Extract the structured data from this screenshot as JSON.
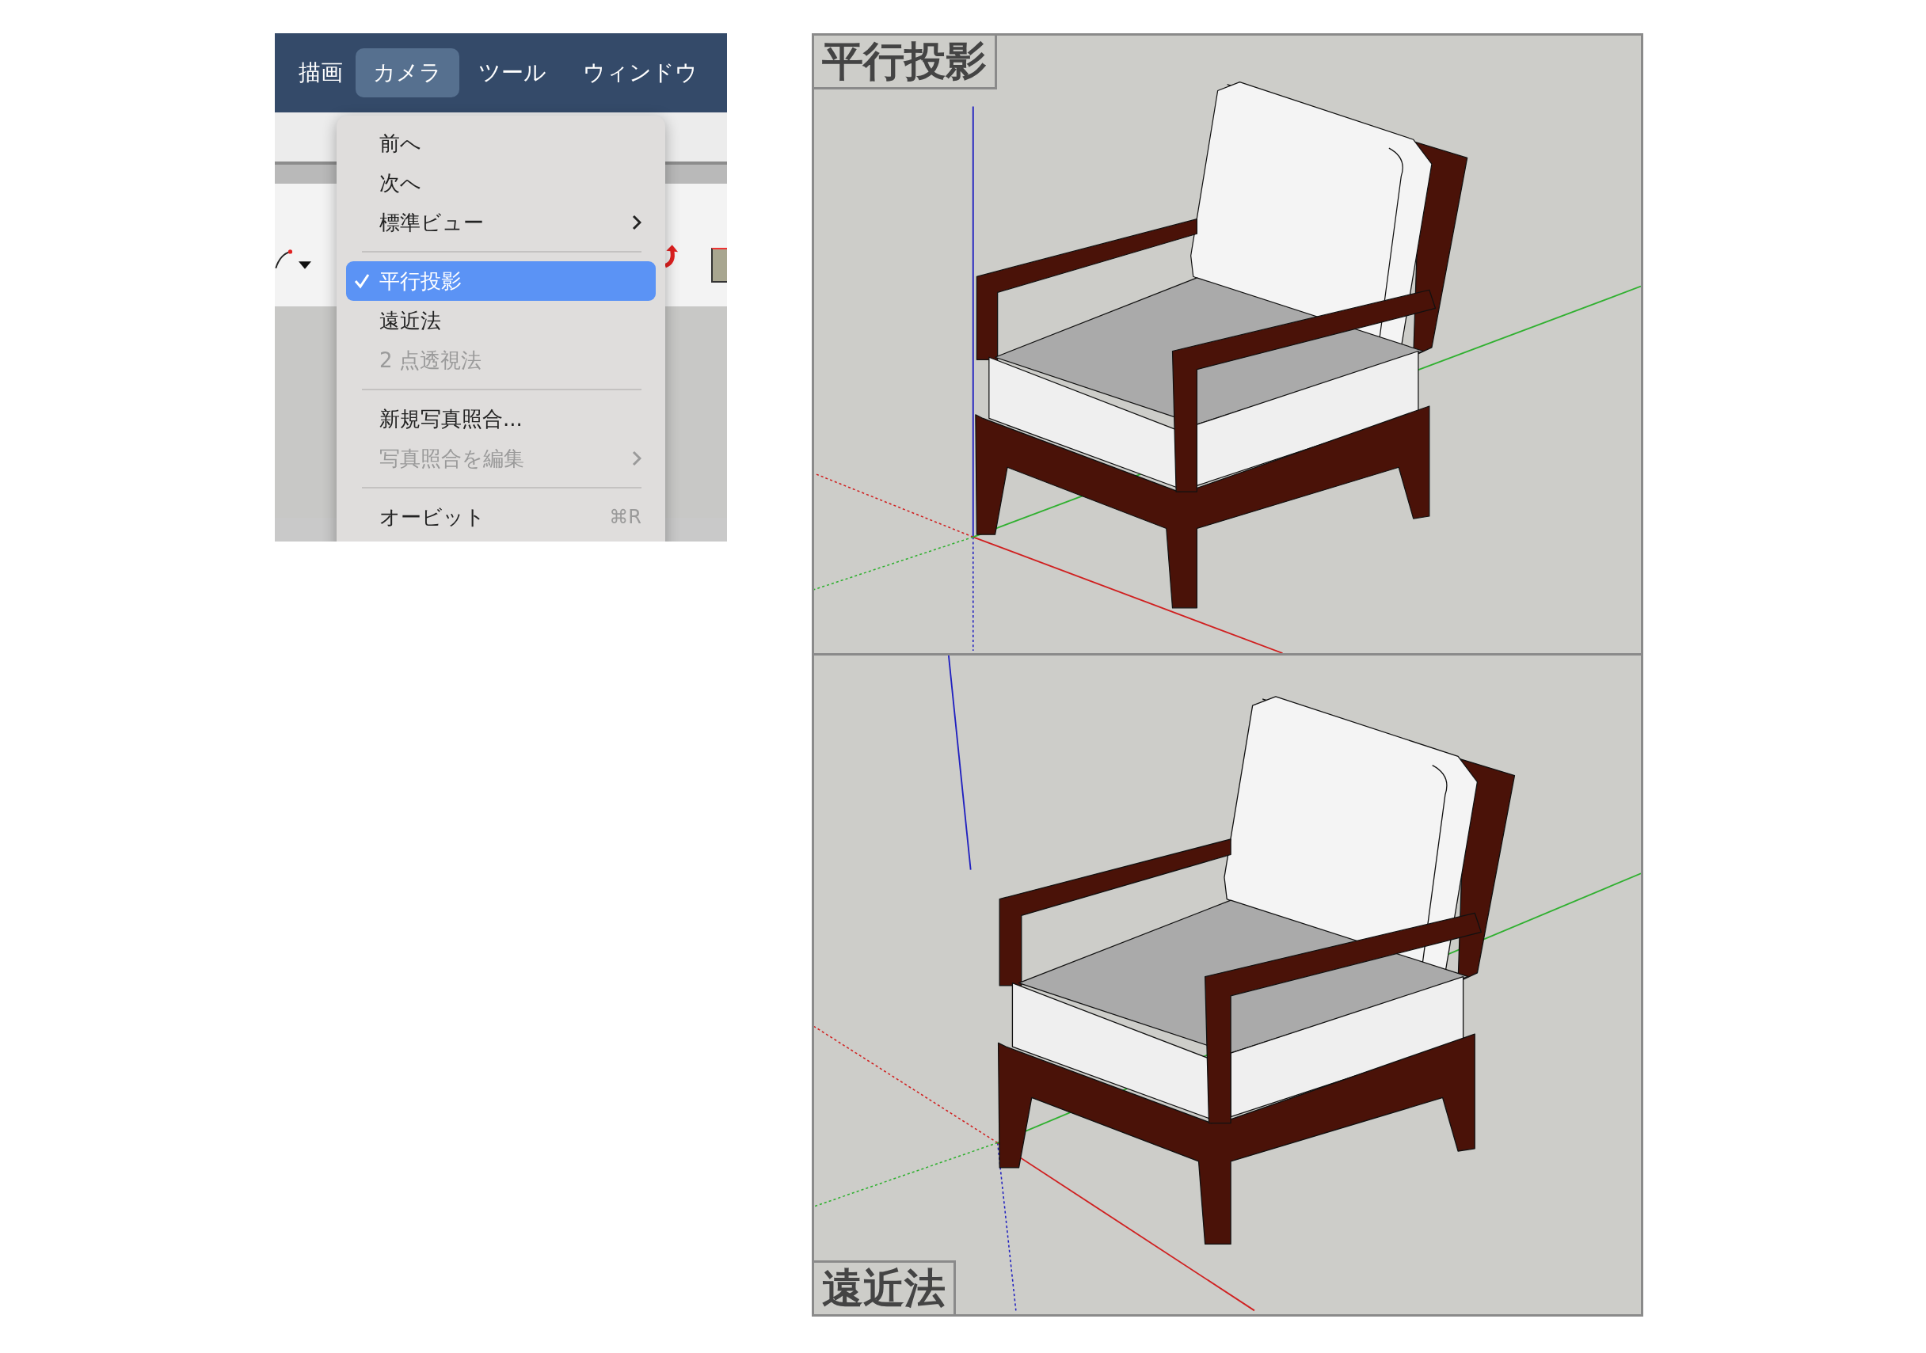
{
  "menu_bar": {
    "items": [
      {
        "label": "描画",
        "selected": false
      },
      {
        "label": "カメラ",
        "selected": true
      },
      {
        "label": "ツール",
        "selected": false
      },
      {
        "label": "ウィンドウ",
        "selected": false
      }
    ]
  },
  "camera_menu": {
    "items": [
      {
        "kind": "item",
        "label": "前へ",
        "checked": false,
        "selected": false,
        "disabled": false,
        "submenu": false
      },
      {
        "kind": "item",
        "label": "次へ",
        "checked": false,
        "selected": false,
        "disabled": false,
        "submenu": false
      },
      {
        "kind": "item",
        "label": "標準ビュー",
        "checked": false,
        "selected": false,
        "disabled": false,
        "submenu": true
      },
      {
        "kind": "separator"
      },
      {
        "kind": "item",
        "label": "平行投影",
        "checked": true,
        "selected": true,
        "disabled": false,
        "submenu": false
      },
      {
        "kind": "item",
        "label": "遠近法",
        "checked": false,
        "selected": false,
        "disabled": false,
        "submenu": false
      },
      {
        "kind": "item",
        "label": "2 点透視法",
        "checked": false,
        "selected": false,
        "disabled": true,
        "submenu": false
      },
      {
        "kind": "separator"
      },
      {
        "kind": "item",
        "label": "新規写真照合...",
        "checked": false,
        "selected": false,
        "disabled": false,
        "submenu": false
      },
      {
        "kind": "item",
        "label": "写真照合を編集",
        "checked": false,
        "selected": false,
        "disabled": true,
        "submenu": true
      },
      {
        "kind": "separator"
      },
      {
        "kind": "item",
        "label": "オービット",
        "shortcut": "⌘R",
        "checked": false,
        "selected": false,
        "disabled": false,
        "submenu": false
      }
    ]
  },
  "views": [
    {
      "kind": "parallel",
      "label": "平行投影"
    },
    {
      "kind": "perspective",
      "label": "遠近法"
    }
  ]
}
